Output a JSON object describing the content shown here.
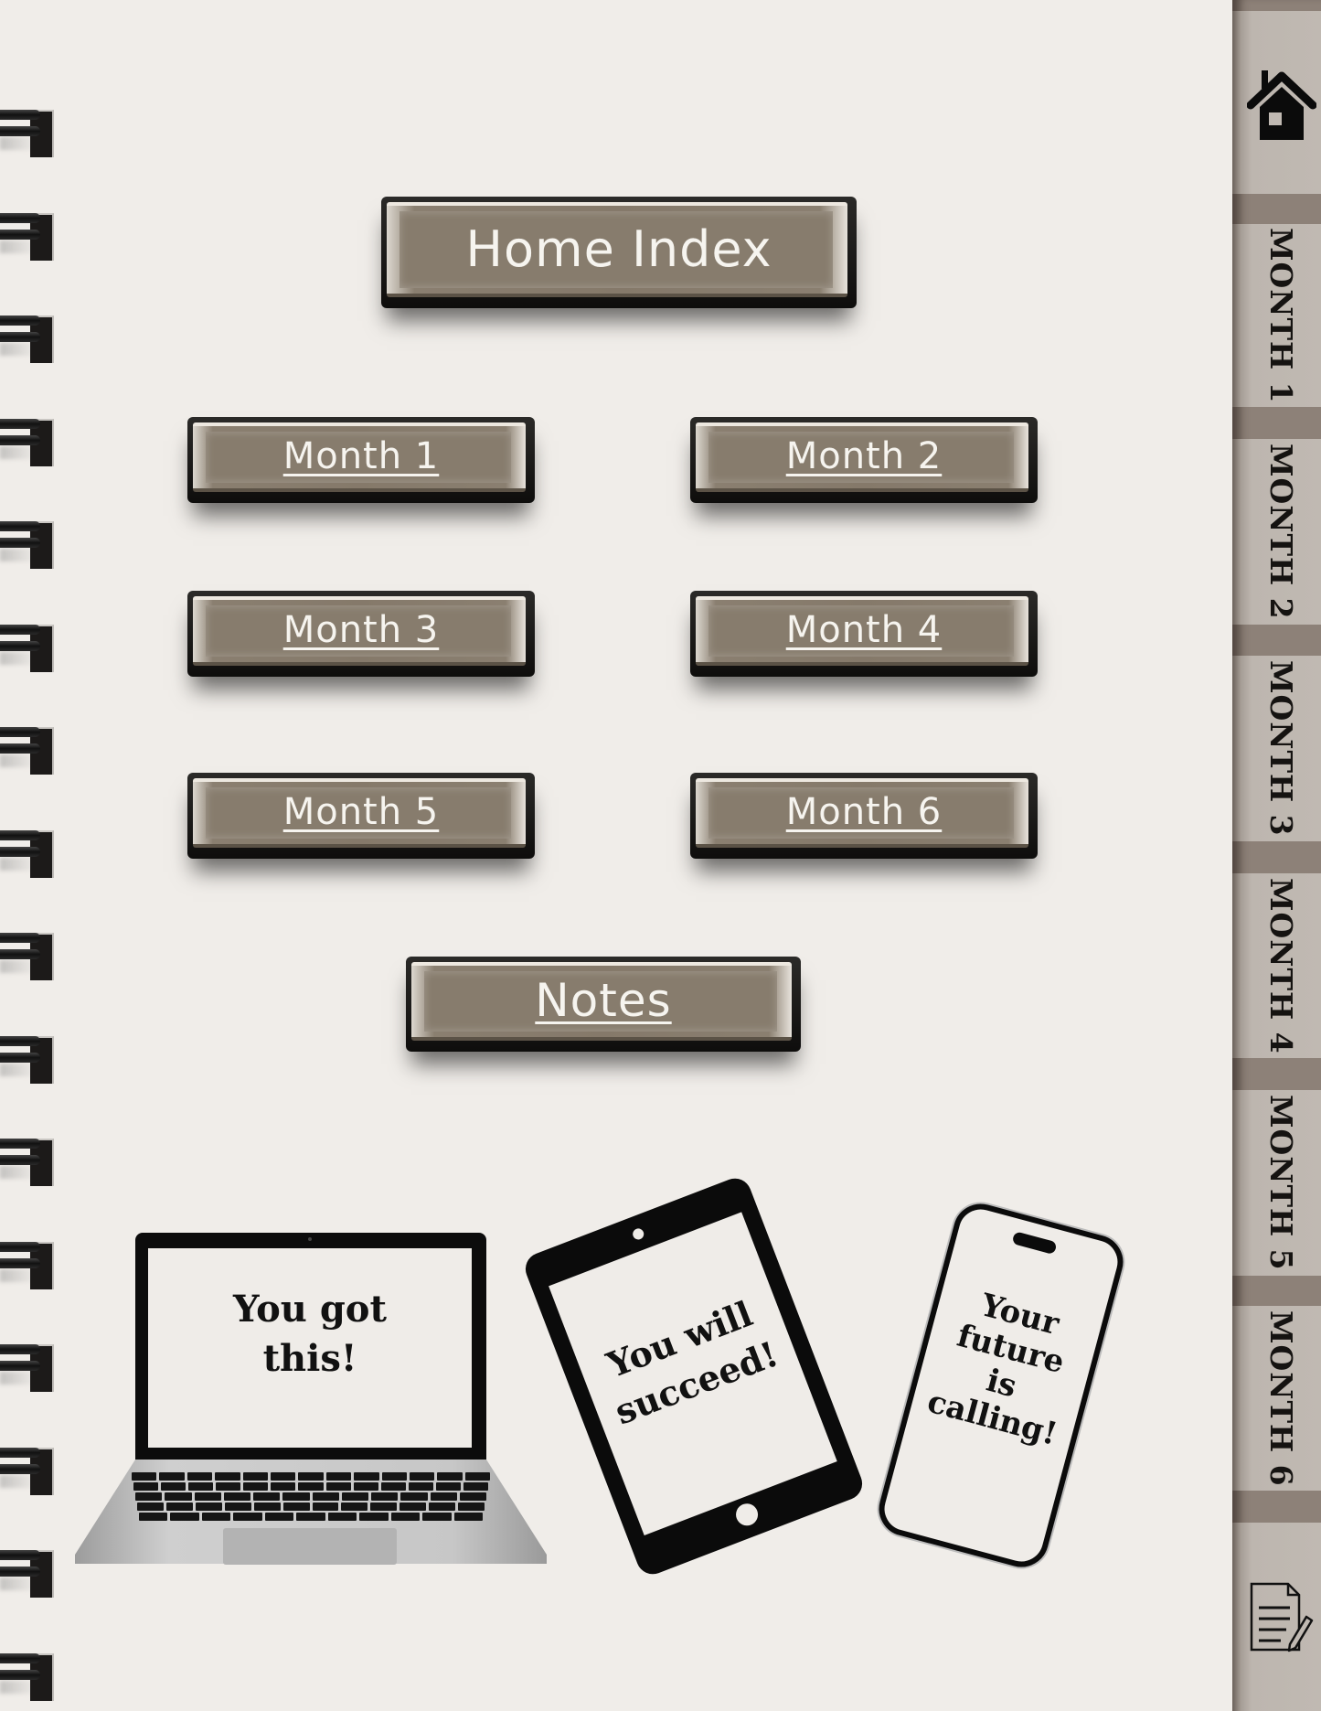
{
  "page": {
    "title_button": "Home Index",
    "month_buttons": [
      "Month 1",
      "Month 2",
      "Month 3",
      "Month 4",
      "Month 5",
      "Month 6"
    ],
    "notes_button": "Notes"
  },
  "side_tabs": {
    "home_icon": "house-icon",
    "months": [
      "MONTH 1",
      "MONTH 2",
      "MONTH 3",
      "MONTH 4",
      "MONTH 5",
      "MONTH 6"
    ],
    "notes_icon": "notes-pencil-icon"
  },
  "devices": {
    "laptop": {
      "line1": "You got",
      "line2": "this!"
    },
    "tablet": {
      "line1": "You will",
      "line2": "succeed!"
    },
    "phone": {
      "line1": "Your",
      "line2": "future",
      "line3": "is",
      "line4": "calling!"
    }
  },
  "colors": {
    "page_bg": "#f0ede9",
    "button_face": "#877c6d",
    "tab_bg": "#c0b9b2",
    "tab_divider": "#8d8178"
  }
}
